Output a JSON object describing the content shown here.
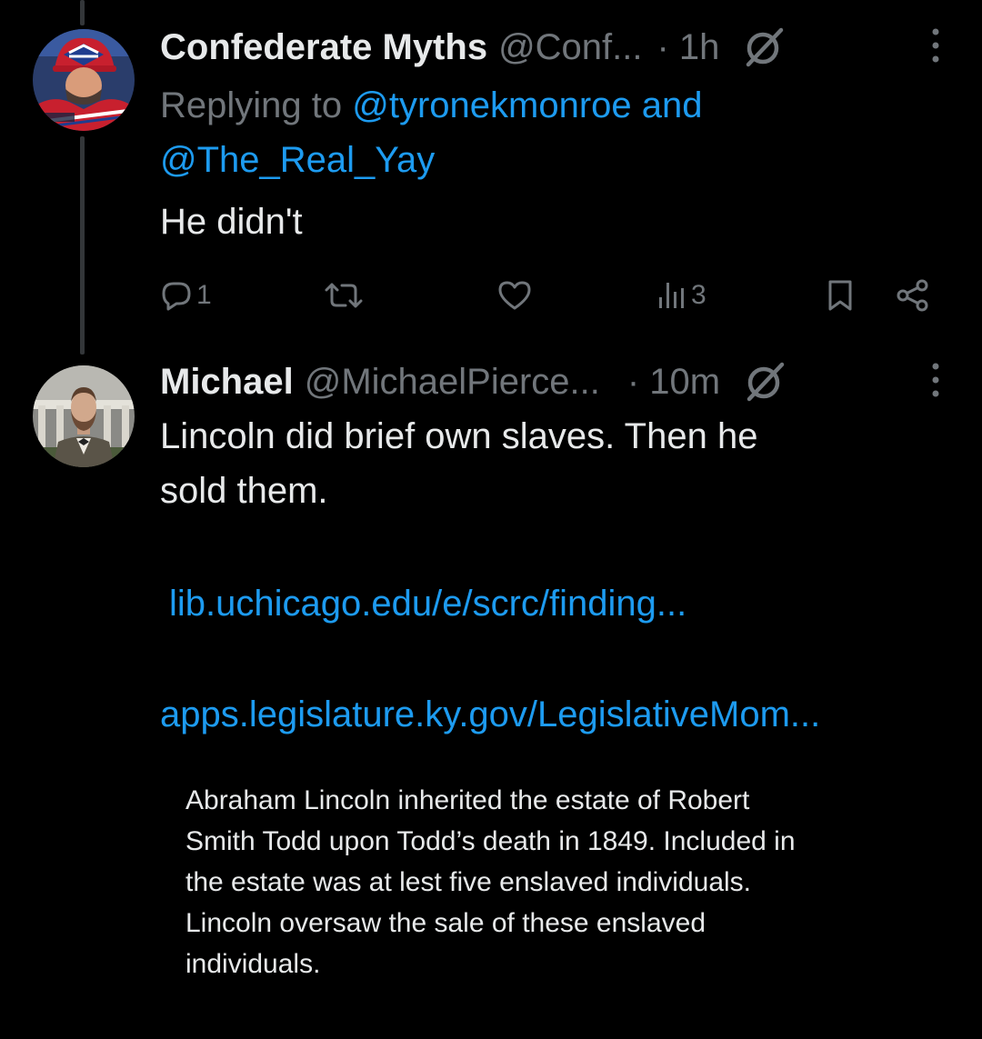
{
  "tweet1": {
    "name": "Confederate Myths",
    "handle": "@Conf...",
    "time": "· 1h",
    "reply_prefix": "Replying to ",
    "reply_user1": "@tyronekmonroe",
    "reply_and": " and",
    "reply_user2": "@The_Real_Yay",
    "text": "He didn't",
    "reply_count": "1",
    "views_count": "3",
    "icons": [
      "grok-icon",
      "more-icon",
      "reply-icon",
      "retweet-icon",
      "like-icon",
      "views-icon",
      "bookmark-icon",
      "share-icon"
    ]
  },
  "tweet2": {
    "name": "Michael",
    "handle": "@MichaelPierce...",
    "time": "· 10m",
    "text_line1": "Lincoln did brief own slaves. Then he",
    "text_line2": "sold them.",
    "link1": "lib.uchicago.edu/e/scrc/finding...",
    "link2": "apps.legislature.ky.gov/LegislativeMom...",
    "quote_line1": "Abraham Lincoln inherited the estate of Robert",
    "quote_line2": "Smith Todd upon Todd’s death in 1849. Included in",
    "quote_line3": "the estate was at lest five enslaved individuals.",
    "quote_line4": "Lincoln oversaw the sale of these enslaved",
    "quote_line5": "individuals."
  },
  "colors": {
    "background": "#000000",
    "text": "#e7e9ea",
    "secondary": "#71767b",
    "link": "#1d9bf0",
    "thread_line": "#333639"
  }
}
